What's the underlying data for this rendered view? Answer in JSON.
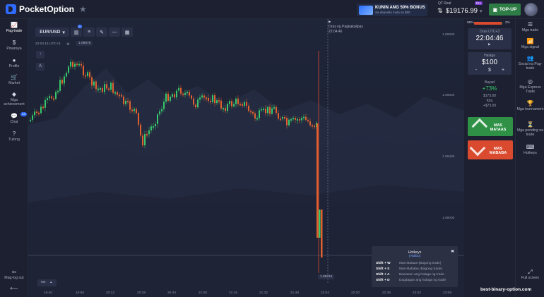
{
  "header": {
    "logo": "PocketOption",
    "bonus_title": "KUNIN ANG 50% BONUS",
    "bonus_sub": "Sa deposito mula sa $50",
    "account_label": "QT Real",
    "account_pro": "Pro",
    "balance": "$19176.99",
    "topup_label": "TOP-UP"
  },
  "left_sidebar": [
    {
      "label": "Pag-trade",
      "icon": "chart-icon",
      "glyph": "📈"
    },
    {
      "label": "Pinansya",
      "icon": "dollar-icon",
      "glyph": "$"
    },
    {
      "label": "Profile",
      "icon": "user-icon",
      "glyph": "●"
    },
    {
      "label": "Market",
      "icon": "cart-icon",
      "glyph": "🛒"
    },
    {
      "label": "Mga achievement",
      "icon": "diamond-icon",
      "glyph": "◆"
    },
    {
      "label": "Chat",
      "icon": "chat-icon",
      "glyph": "💬",
      "badge": "14"
    },
    {
      "label": "Tulong",
      "icon": "help-icon",
      "glyph": "?"
    }
  ],
  "logout_label": "Mag-log out",
  "toolbar": {
    "pair": "EUR/USD",
    "indicator_badge": "01"
  },
  "chart": {
    "server_time": "22:04:14 UTC+3",
    "price_tag": "1.08576",
    "expiry_label": "Oras ng Pagkakalipas",
    "expiry_time": "22:04:46",
    "current_price": "1.08215",
    "timeframe": "M4",
    "y_ticks": [
      "1.08600",
      "1.08500",
      "1.08400",
      "1.08000"
    ],
    "x_ticks": [
      "19:40",
      "19:56",
      "20:12",
      "20:28",
      "20:44",
      "21:00",
      "21:16",
      "21:32",
      "21:48",
      "22:04",
      "22:20",
      "22:36",
      "22:52",
      "23:08"
    ]
  },
  "chart_data": {
    "type": "candlestick",
    "series": [
      {
        "name": "EUR/USD"
      }
    ],
    "x_range": [
      "19:40",
      "23:08"
    ]
  },
  "right_panel": {
    "pct_left": "98%",
    "pct_right": "2%",
    "pct_value": 0.98,
    "time_label": "Oras UTC+3",
    "time_value": "22:04:46",
    "amount_label": "Halaga",
    "amount_value": "$100",
    "minus": "-",
    "currency": "$",
    "plus": "+",
    "payout_label": "Bayad",
    "payout_pct": "+73%",
    "payout_amount": "$173.00",
    "profit_label": "Kita",
    "profit_amount": "+$73.00",
    "up_label": "MAS MATAAS",
    "down_label": "MAS MABABA"
  },
  "right_sidebar": [
    {
      "label": "Mga trade",
      "icon": "trades-icon",
      "glyph": "☰"
    },
    {
      "label": "Mga signal",
      "icon": "signal-icon",
      "glyph": "📶"
    },
    {
      "label": "Social na Pag-trade",
      "icon": "social-icon",
      "glyph": "👥"
    },
    {
      "label": "Mga Express Trade",
      "icon": "express-icon",
      "glyph": "◎"
    },
    {
      "label": "Mga tournament",
      "icon": "trophy-icon",
      "glyph": "🏆"
    },
    {
      "label": "Mga pending na trade",
      "icon": "pending-icon",
      "glyph": "⏳"
    },
    {
      "label": "Hotkeys",
      "icon": "keyboard-icon",
      "glyph": "⌨"
    }
  ],
  "fullscreen_label": "Full screen",
  "hotkeys": {
    "title": "Hotkeys",
    "subtitle": "(Aktibo)",
    "rows": [
      {
        "key": "Shift + W",
        "desc": "Mas Mataas (Bagong trade)"
      },
      {
        "key": "Shift + S",
        "desc": "Mas Mababa (Bagong trade)"
      },
      {
        "key": "Shift + A",
        "desc": "Bawasan ang halaga ng trade"
      },
      {
        "key": "Shift + D",
        "desc": "Dagdagan ang halaga ng trade"
      }
    ]
  },
  "watermark": "best-binary-option.com"
}
